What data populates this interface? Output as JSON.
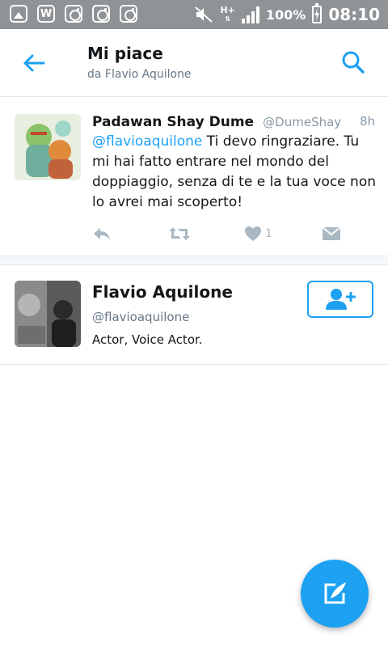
{
  "status_bar": {
    "icons": [
      "gallery-icon",
      "w-icon",
      "instagram-icon",
      "instagram-icon",
      "instagram-icon",
      "mute-icon",
      "signal-icon",
      "battery-charging-icon"
    ],
    "network": "H+",
    "battery": "100%",
    "time": "08:10"
  },
  "header": {
    "title": "Mi piace",
    "subtitle": "da Flavio Aquilone"
  },
  "tweet": {
    "author_name": "Padawan Shay Dume",
    "author_handle": "@DumeShay",
    "time": "8h",
    "mention": "@flavioaquilone",
    "text": " Ti devo ringraziare. Tu mi hai fatto entrare nel mondo del doppiaggio, senza di te e la tua voce non lo avrei mai scoperto!",
    "like_count": "1"
  },
  "user": {
    "name": "Flavio Aquilone",
    "handle": "@flavioaquilone",
    "bio": "Actor, Voice Actor."
  },
  "colors": {
    "accent": "#1da1f2",
    "status_bar": "#8f9396",
    "secondary_text": "#8899a6",
    "divider": "#e1e8ed"
  }
}
